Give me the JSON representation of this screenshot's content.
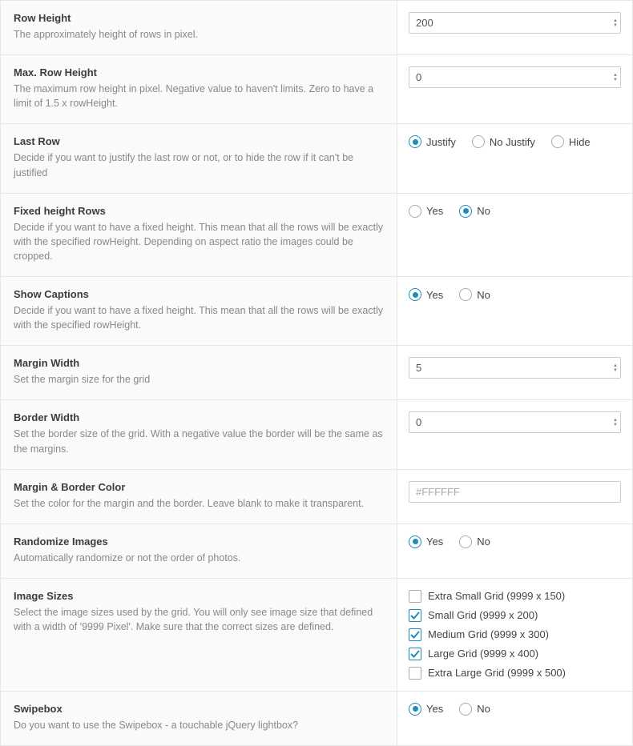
{
  "rows": {
    "row_height": {
      "title": "Row Height",
      "desc": "The approximately height of rows in pixel.",
      "value": "200"
    },
    "max_row_height": {
      "title": "Max. Row Height",
      "desc": "The maximum row height in pixel. Negative value to haven't limits. Zero to have a limit of 1.5 x rowHeight.",
      "value": "0"
    },
    "last_row": {
      "title": "Last Row",
      "desc": "Decide if you want to justify the last row or not, or to hide the row if it can't be justified",
      "options": {
        "justify": "Justify",
        "no_justify": "No Justify",
        "hide": "Hide"
      }
    },
    "fixed_height": {
      "title": "Fixed height Rows",
      "desc": "Decide if you want to have a fixed height. This mean that all the rows will be exactly with the specified rowHeight. Depending on aspect ratio the images could be cropped.",
      "options": {
        "yes": "Yes",
        "no": "No"
      }
    },
    "show_captions": {
      "title": "Show Captions",
      "desc": "Decide if you want to have a fixed height. This mean that all the rows will be exactly with the specified rowHeight.",
      "options": {
        "yes": "Yes",
        "no": "No"
      }
    },
    "margin_width": {
      "title": "Margin Width",
      "desc": "Set the margin size for the grid",
      "value": "5"
    },
    "border_width": {
      "title": "Border Width",
      "desc": "Set the border size of the grid. With a negative value the border will be the same as the margins.",
      "value": "0"
    },
    "margin_color": {
      "title": "Margin & Border Color",
      "desc": "Set the color for the margin and the border. Leave blank to make it transparent.",
      "placeholder": "#FFFFFF"
    },
    "randomize": {
      "title": "Randomize Images",
      "desc": "Automatically randomize or not the order of photos.",
      "options": {
        "yes": "Yes",
        "no": "No"
      }
    },
    "image_sizes": {
      "title": "Image Sizes",
      "desc": "Select the image sizes used by the grid. You will only see image size that defined with a width of '9999 Pixel'. Make sure that the correct sizes are defined.",
      "options": {
        "xs": "Extra Small Grid (9999 x 150)",
        "sm": "Small Grid (9999 x 200)",
        "md": "Medium Grid (9999 x 300)",
        "lg": "Large Grid (9999 x 400)",
        "xl": "Extra Large Grid (9999 x 500)"
      }
    },
    "swipebox": {
      "title": "Swipebox",
      "desc": "Do you want to use the Swipebox - a touchable jQuery lightbox?",
      "options": {
        "yes": "Yes",
        "no": "No"
      }
    }
  }
}
